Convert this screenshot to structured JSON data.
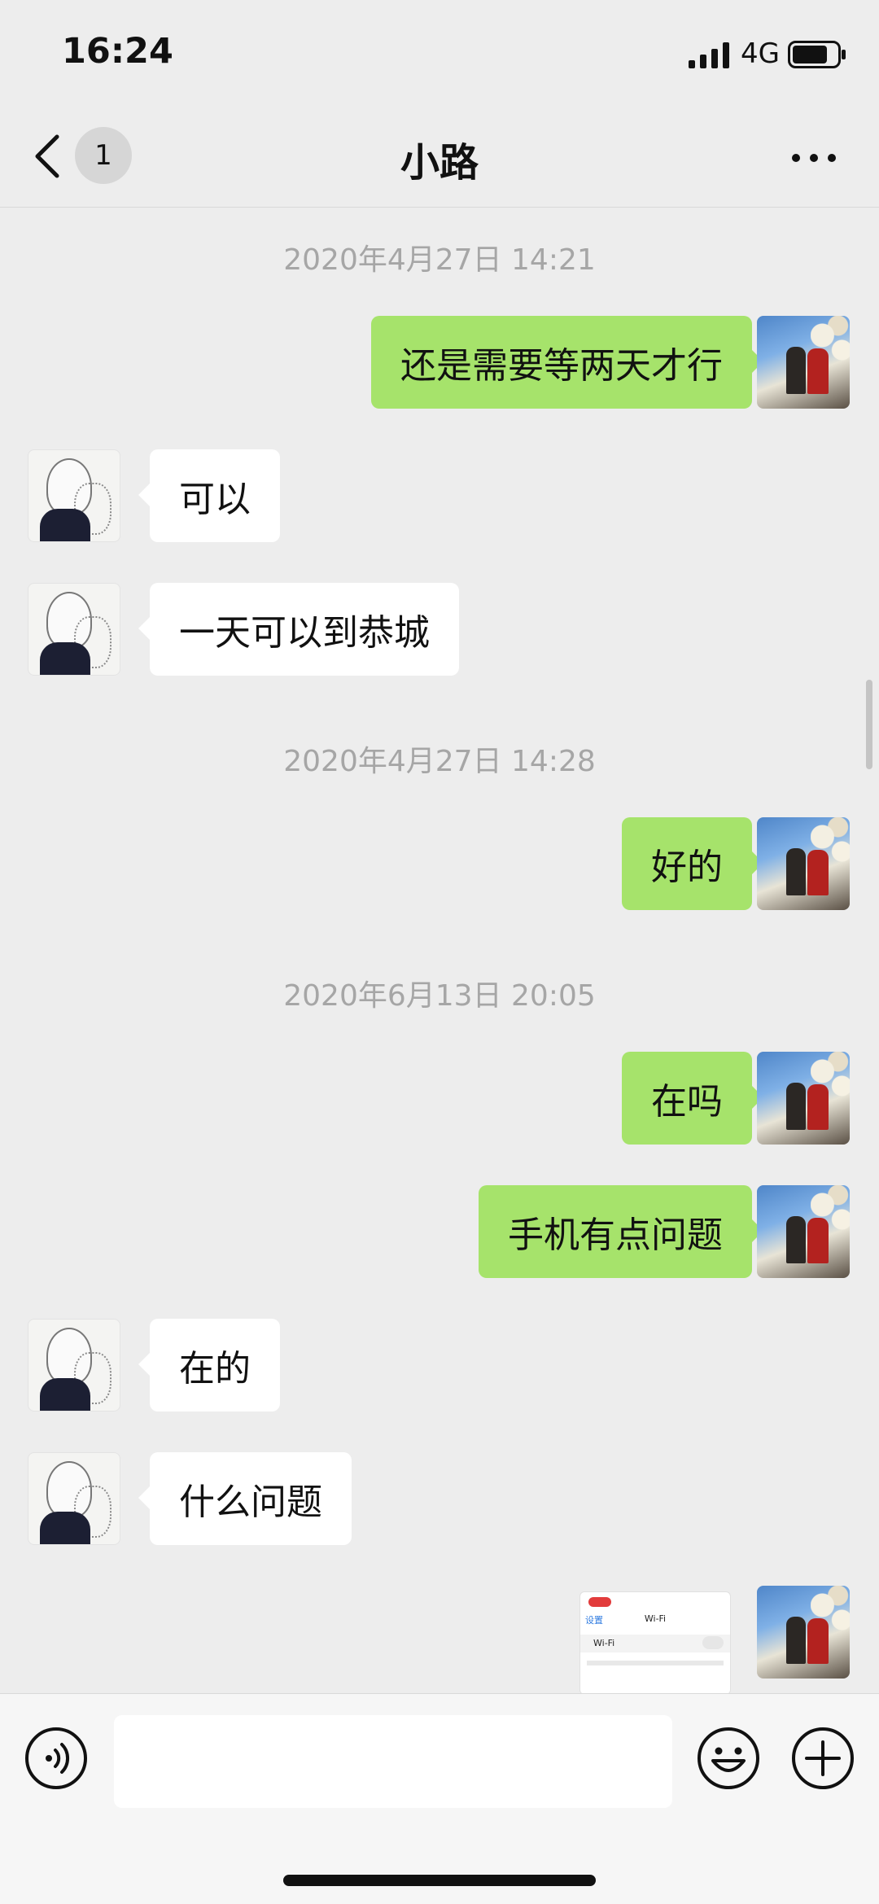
{
  "status_bar": {
    "time": "16:24",
    "network": "4G"
  },
  "nav": {
    "unread_badge": "1",
    "title": "小路"
  },
  "messages": [
    {
      "type": "timestamp",
      "text": "2020年4月27日 14:21"
    },
    {
      "type": "me",
      "text": "还是需要等两天才行"
    },
    {
      "type": "other",
      "text": "可以"
    },
    {
      "type": "other",
      "text": "一天可以到恭城"
    },
    {
      "type": "timestamp",
      "text": "2020年4月27日 14:28"
    },
    {
      "type": "me",
      "text": "好的"
    },
    {
      "type": "timestamp",
      "text": "2020年6月13日 20:05"
    },
    {
      "type": "me",
      "text": "在吗"
    },
    {
      "type": "me",
      "text": "手机有点问题"
    },
    {
      "type": "other",
      "text": "在的"
    },
    {
      "type": "other",
      "text": "什么问题"
    },
    {
      "type": "me_image",
      "thumbnail": {
        "back_label": "设置",
        "title": "Wi-Fi",
        "row_label": "Wi-Fi"
      }
    }
  ],
  "colors": {
    "me_bubble": "#a6e36b",
    "other_bubble": "#ffffff",
    "background": "#ededed"
  }
}
